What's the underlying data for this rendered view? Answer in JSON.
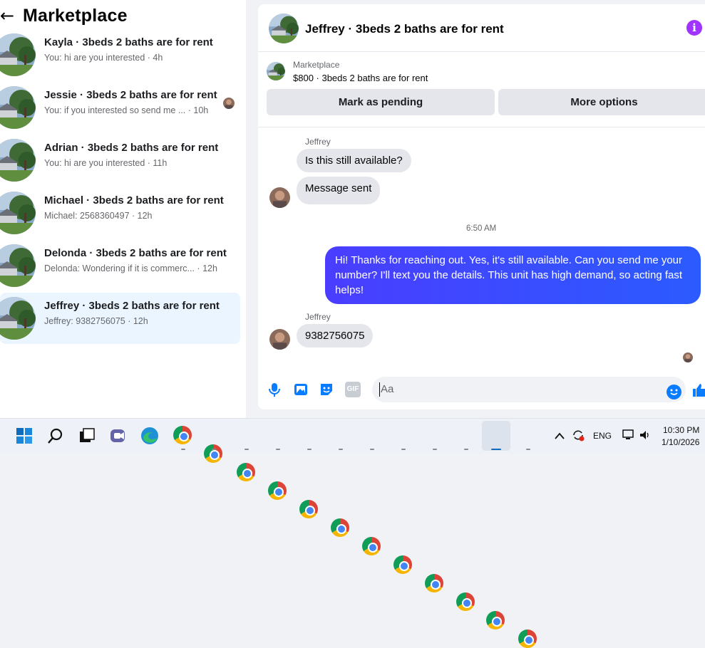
{
  "left_panel": {
    "title": "Marketplace",
    "conversations": [
      {
        "title": "Kayla · 3beds 2 baths are for rent",
        "subtitle": "You: hi are you interested · 4h"
      },
      {
        "title": "Jessie · 3beds 2 baths are for rent",
        "subtitle": "You: if you interested so send me ... · 10h"
      },
      {
        "title": "Adrian · 3beds 2 baths are for rent",
        "subtitle": "You: hi are you interested · 11h"
      },
      {
        "title": "Michael · 3beds 2 baths are for rent",
        "subtitle": "Michael: 2568360497 · 12h"
      },
      {
        "title": "Delonda · 3beds 2 baths are for rent",
        "subtitle": "Delonda: Wondering if it is commerc... · 12h"
      },
      {
        "title": "Jeffrey · 3beds 2 baths are for rent",
        "subtitle": "Jeffrey: 9382756075 · 12h"
      }
    ]
  },
  "chat": {
    "title": "Jeffrey · 3beds 2 baths are for rent",
    "listing_source": "Marketplace",
    "listing_price": "$800 · 3beds 2 baths are for rent",
    "btn_pending": "Mark as pending",
    "btn_more": "More options",
    "sender_1": "Jeffrey",
    "msg_1": "Is this still available?",
    "msg_2": "Message sent",
    "timestamp": "6:50 AM",
    "msg_out": "Hi! Thanks for reaching out. Yes, it's still available. Can you send me your number? I'll text you the details. This unit has high demand, so acting fast helps!",
    "sender_2": "Jeffrey",
    "msg_3": "9382756075",
    "input_placeholder": "Aa",
    "gif_label": "GIF"
  },
  "taskbar": {
    "lang": "ENG",
    "time": "10:30 PM",
    "date": "1/10/2026"
  },
  "colors": {
    "accent": "#0a7cff",
    "outgoing_bubble": "#3b4bff",
    "info": "#a033ff",
    "active_row": "#ebf5ff"
  },
  "icons": [
    "back-arrow-icon",
    "info-icon",
    "microphone-icon",
    "photo-icon",
    "sticker-icon",
    "gif-icon",
    "emoji-icon",
    "like-icon",
    "windows-start-icon",
    "search-icon",
    "task-view-icon",
    "teams-icon",
    "edge-icon",
    "chrome-icon",
    "chevron-up-icon",
    "sync-icon",
    "network-icon",
    "volume-icon"
  ]
}
